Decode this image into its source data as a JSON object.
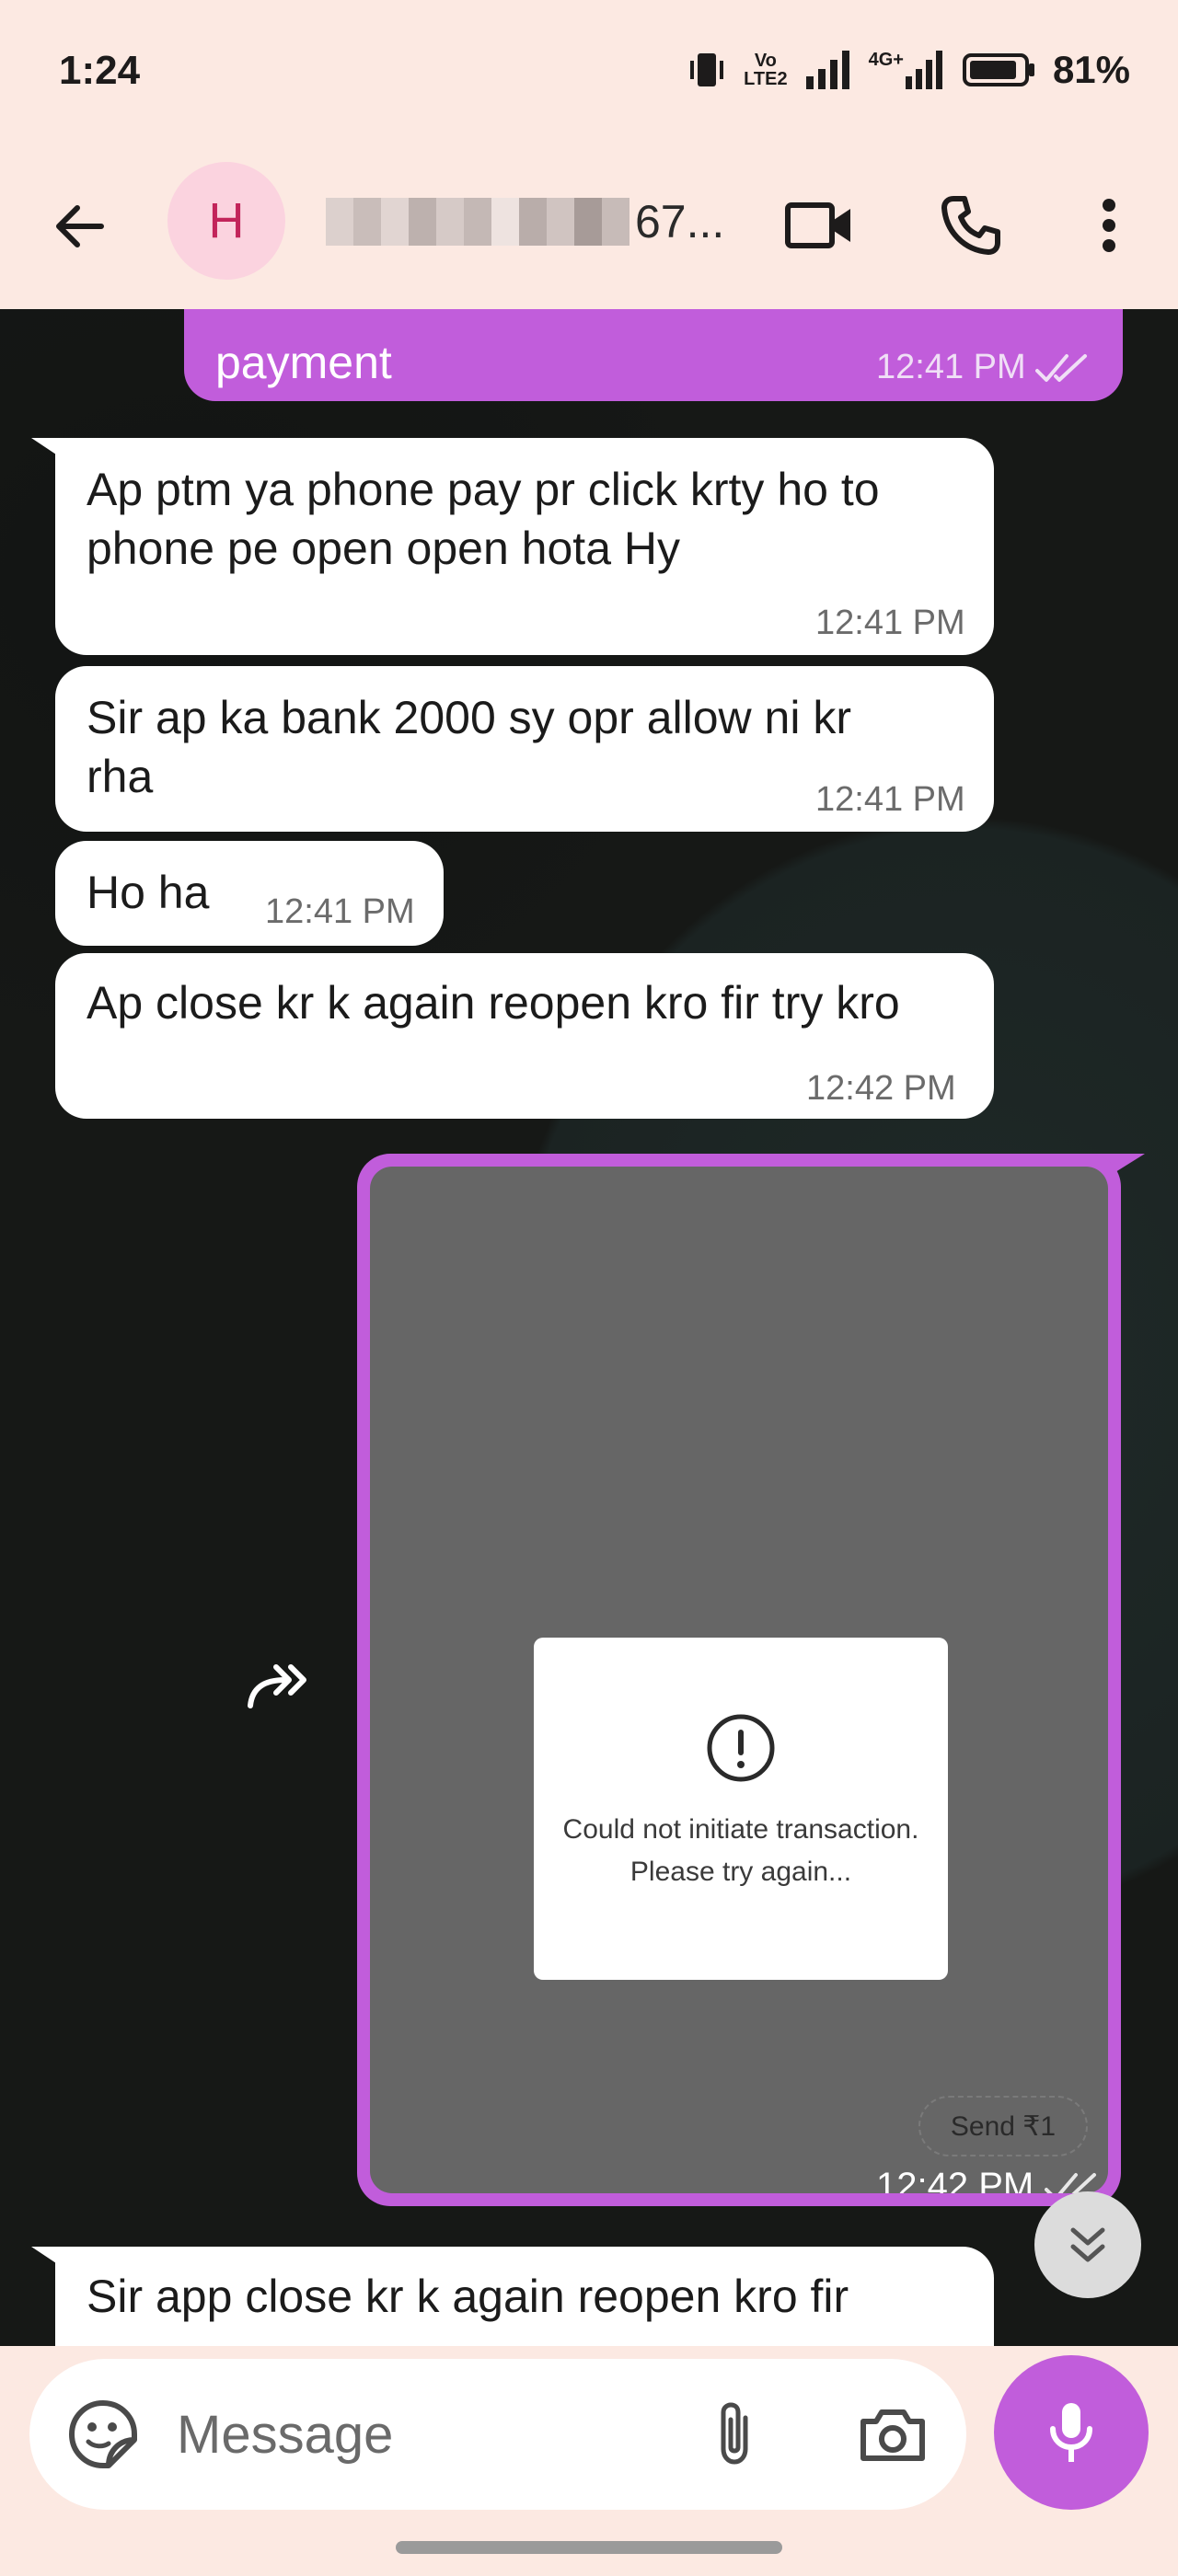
{
  "status_bar": {
    "time": "1:24",
    "volte_top": "Vo",
    "volte_bottom": "LTE2",
    "net_label": "4G+",
    "battery": "81%"
  },
  "header": {
    "avatar_letter": "H",
    "contact_suffix": "67...",
    "accent": "#c15ddb",
    "bar_color": "#fce9e2"
  },
  "messages": [
    {
      "dir": "out",
      "text": "payment",
      "time": "12:41 PM"
    },
    {
      "dir": "in",
      "text": "Ap ptm ya phone pay pr click krty ho to phone pe open open hota Hy",
      "time": "12:41 PM"
    },
    {
      "dir": "in",
      "text": "Sir ap ka bank 2000 sy opr allow ni kr rha",
      "time": "12:41 PM"
    },
    {
      "dir": "in",
      "text": "Ho ha",
      "time": "12:41 PM"
    },
    {
      "dir": "in",
      "text": "Ap close kr k again reopen kro fir try kro",
      "time": "12:42 PM"
    },
    {
      "dir": "in",
      "text": "Sir app close kr k again reopen kro fir",
      "time": ""
    }
  ],
  "image_message": {
    "dialog_text": "Could not initiate transaction. Please try again...",
    "send_chip": "Send ₹1",
    "time": "12:42 PM"
  },
  "composer": {
    "placeholder": "Message"
  }
}
